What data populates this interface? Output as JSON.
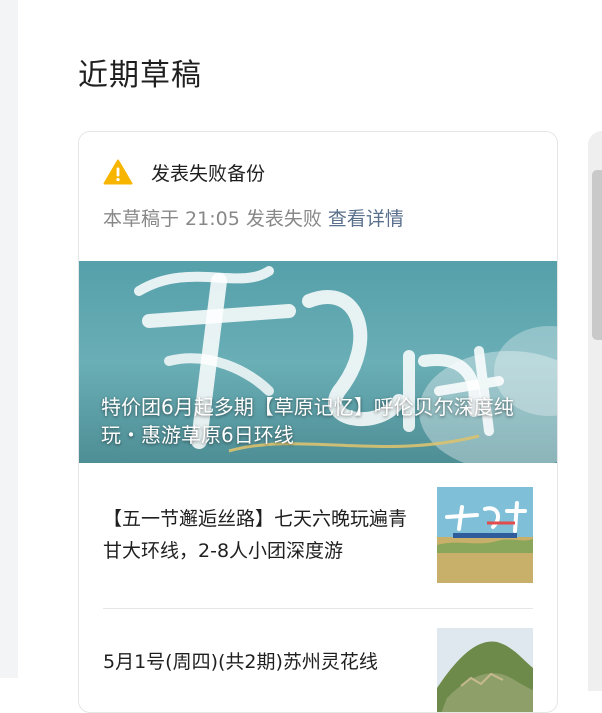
{
  "page": {
    "title": "近期草稿"
  },
  "draft_card": {
    "status_title": "发表失败备份",
    "status_message": "本草稿于 21:05 发表失败",
    "details_link": "查看详情",
    "banner": {
      "caption": "特价团6月起多期【草原记忆】呼伦贝尔深度纯玩・惠游草原6日环线"
    },
    "posts": [
      {
        "title": "【五一节邂逅丝路】七天六晚玩遍青甘大环线，2-8人小团深度游",
        "thumbnail": "silk-road-poster"
      },
      {
        "title": "5月1号(周四)(共2期)苏州灵花线",
        "thumbnail": "mountain-photo"
      }
    ]
  },
  "colors": {
    "warning": "#f7b500",
    "link": "#5a6f8c",
    "banner": "#5da3ad"
  }
}
